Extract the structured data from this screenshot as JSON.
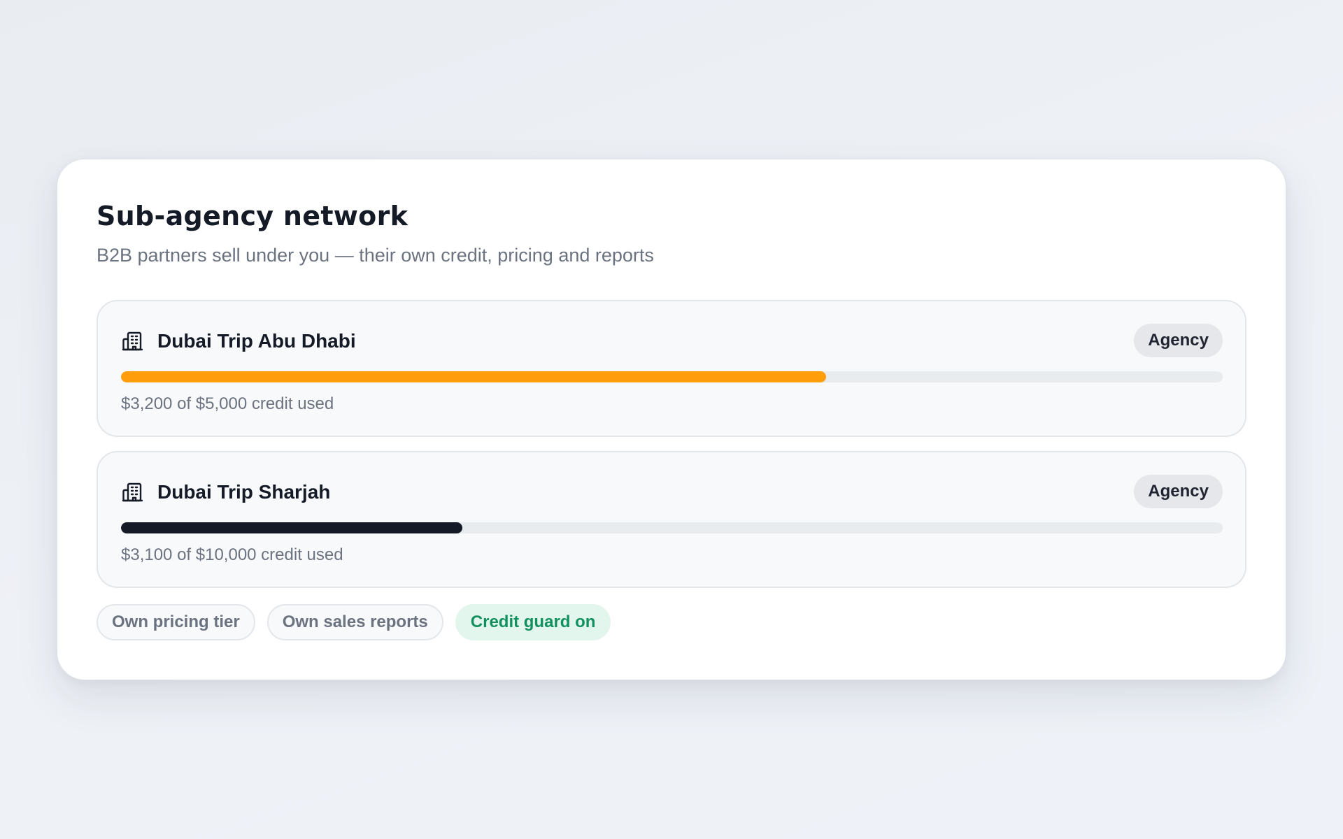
{
  "header": {
    "title": "Sub-agency network",
    "subtitle": "B2B partners sell under you — their own credit, pricing and reports"
  },
  "partners": [
    {
      "name": "Dubai Trip Abu Dhabi",
      "badge": "Agency",
      "icon": "building-icon",
      "credit_used": 3200,
      "credit_limit": 5000,
      "usage_text": "$3,200 of $5,000 credit used",
      "bar_color": "#ff9d0a"
    },
    {
      "name": "Dubai Trip Sharjah",
      "badge": "Agency",
      "icon": "building-icon",
      "credit_used": 3100,
      "credit_limit": 10000,
      "usage_text": "$3,100 of $10,000 credit used",
      "bar_color": "#141a26"
    }
  ],
  "chips": [
    {
      "label": "Own pricing tier"
    },
    {
      "label": "Own sales reports"
    },
    {
      "label": "Credit guard on",
      "color": "#12915f"
    }
  ]
}
